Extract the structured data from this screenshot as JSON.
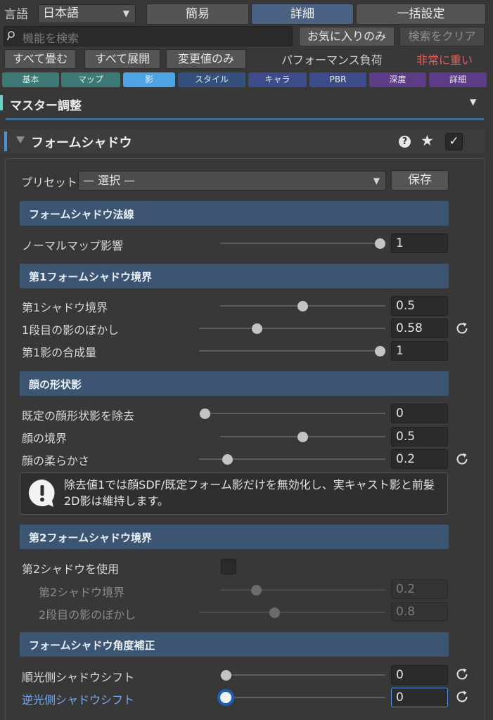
{
  "top": {
    "language_label": "言語",
    "language_value": "日本語",
    "mode_tabs": [
      "簡易",
      "詳細",
      "一括設定"
    ],
    "active_mode": "詳細"
  },
  "search": {
    "placeholder": "機能を検索",
    "favorites_label": "お気に入りのみ",
    "clear_label": "検索をクリア"
  },
  "actions": {
    "collapse_all": "すべて畳む",
    "expand_all": "すべて展開",
    "changed_only": "変更値のみ",
    "performance_label": "パフォーマンス負荷",
    "performance_value": "非常に重い"
  },
  "categories": [
    {
      "label": "基本",
      "color": "#3d7a76"
    },
    {
      "label": "マップ",
      "color": "#3d7a76"
    },
    {
      "label": "影",
      "color": "#4ea4e2"
    },
    {
      "label": "スタイル",
      "color": "#34507c"
    },
    {
      "label": "キャラ",
      "color": "#3c4c8a"
    },
    {
      "label": "PBR",
      "color": "#3c4c8a"
    },
    {
      "label": "深度",
      "color": "#5c3c86"
    },
    {
      "label": "詳細",
      "color": "#5c3c86"
    }
  ],
  "active_category": "影",
  "master": {
    "title": "マスター調整"
  },
  "section": {
    "title": "フォームシャドウ",
    "enabled": true
  },
  "preset": {
    "label": "プリセット",
    "value": "— 選択 —",
    "save_label": "保存"
  },
  "groups": {
    "normal": {
      "title": "フォームシャドウ法線",
      "normal_map_influence": {
        "label": "ノーマルマップ影響",
        "value": "1",
        "level": 1.0
      }
    },
    "border1": {
      "title": "第1フォームシャドウ境界",
      "shadow_border": {
        "label": "第1シャドウ境界",
        "value": "0.5",
        "level": 0.5
      },
      "blur": {
        "label": "1段目の影のぼかし",
        "value": "0.58",
        "level": 0.3
      },
      "blend": {
        "label": "第1影の合成量",
        "value": "1",
        "level": 1.0
      }
    },
    "face": {
      "title": "顔の形状影",
      "remove_default": {
        "label": "既定の顔形状影を除去",
        "value": "0",
        "level": 0.0
      },
      "face_border": {
        "label": "顔の境界",
        "value": "0.5",
        "level": 0.5
      },
      "face_softness": {
        "label": "顔の柔らかさ",
        "value": "0.2",
        "level": 0.13
      },
      "note": "除去値1では顔SDF/既定フォーム影だけを無効化し、実キャスト影と前髪2D影は維持します。"
    },
    "border2": {
      "title": "第2フォームシャドウ境界",
      "use_second": {
        "label": "第2シャドウを使用",
        "checked": false
      },
      "shadow_border2": {
        "label": "第2シャドウ境界",
        "value": "0.2",
        "level": 0.2
      },
      "blur2": {
        "label": "2段目の影のぼかし",
        "value": "0.8",
        "level": 0.4
      }
    },
    "angle": {
      "title": "フォームシャドウ角度補正",
      "lit_side_shift": {
        "label": "順光側シャドウシフト",
        "value": "0",
        "level": 0.0
      },
      "back_side_shift": {
        "label": "逆光側シャドウシフト",
        "value": "0",
        "level": 0.0
      }
    }
  }
}
